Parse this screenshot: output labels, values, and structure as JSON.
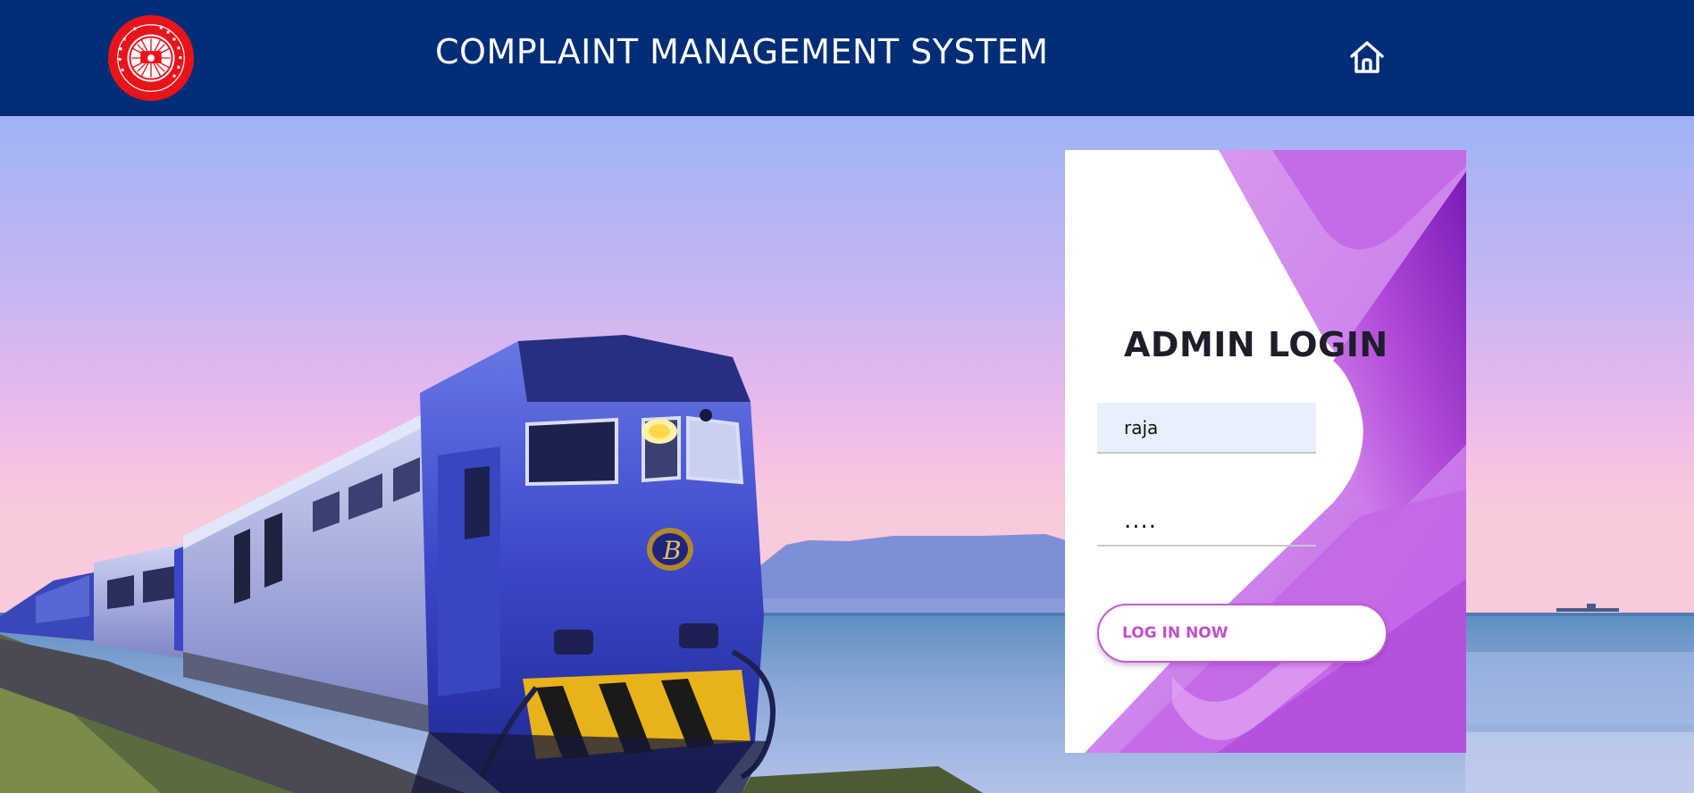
{
  "header": {
    "logo_text": "INDIAN RAILWAYS",
    "title": "COMPLAINT MANAGEMENT SYSTEM",
    "home_icon": "home-icon"
  },
  "login": {
    "title": "ADMIN LOGIN",
    "username_value": "raja",
    "password_value": "....",
    "button_label": "LOG IN NOW"
  },
  "colors": {
    "header_bg": "#002d76",
    "accent_purple": "#b04ad8",
    "button_text": "#c050c8"
  }
}
